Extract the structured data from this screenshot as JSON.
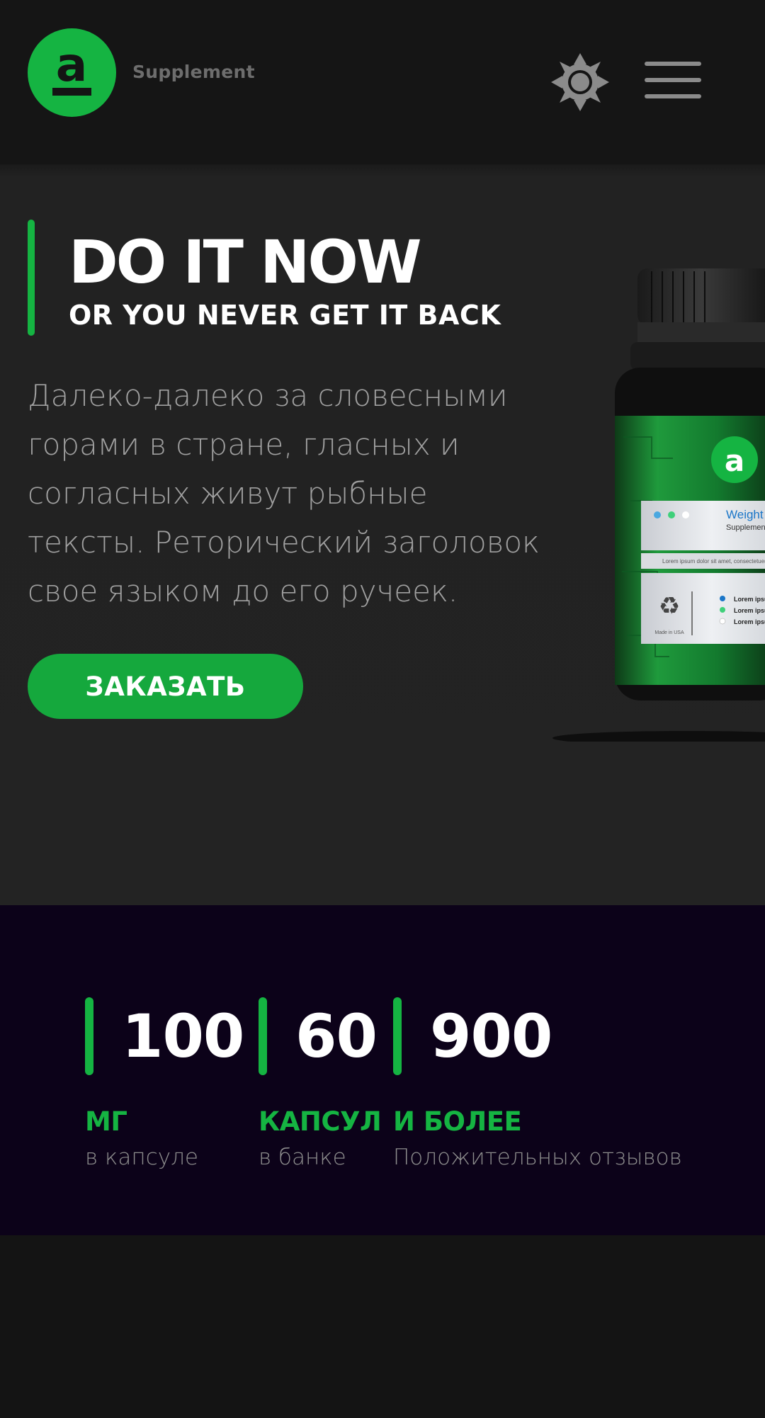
{
  "header": {
    "logo_letter": "a",
    "brand_name": "Supplement",
    "theme_toggle_icon": "sun-icon",
    "menu_icon": "hamburger-menu-icon"
  },
  "hero": {
    "title": "DO IT NOW",
    "subtitle": "OR YOU NEVER GET IT BACK",
    "text": "Далеко-далеко за словесными горами в стране, гласных и согласных живут рыбные тексты. Реторический заголовок свое языком до его ручеек.",
    "order_button_label": "ЗАКАЗАТЬ",
    "product_label": {
      "title": "Weight",
      "subtitle": "Supplement",
      "tagline": "Lorem ipsum dolor sit amet, consectetuer a",
      "made_in": "Made in USA",
      "list_items": [
        "Lorem ipsu",
        "Lorem ipsu",
        "Lorem ipsu"
      ]
    }
  },
  "stats": [
    {
      "number": "100",
      "unit": "МГ",
      "caption": "в капсуле"
    },
    {
      "number": "60",
      "unit": "КАПСУЛ",
      "caption": "в банке"
    },
    {
      "number": "900",
      "unit": "И БОЛЕЕ",
      "caption": "Положительных отзывов"
    }
  ],
  "colors": {
    "accent": "#15b442",
    "background": "#151515",
    "hero_background": "#232323",
    "stats_background": "#0c0219"
  }
}
